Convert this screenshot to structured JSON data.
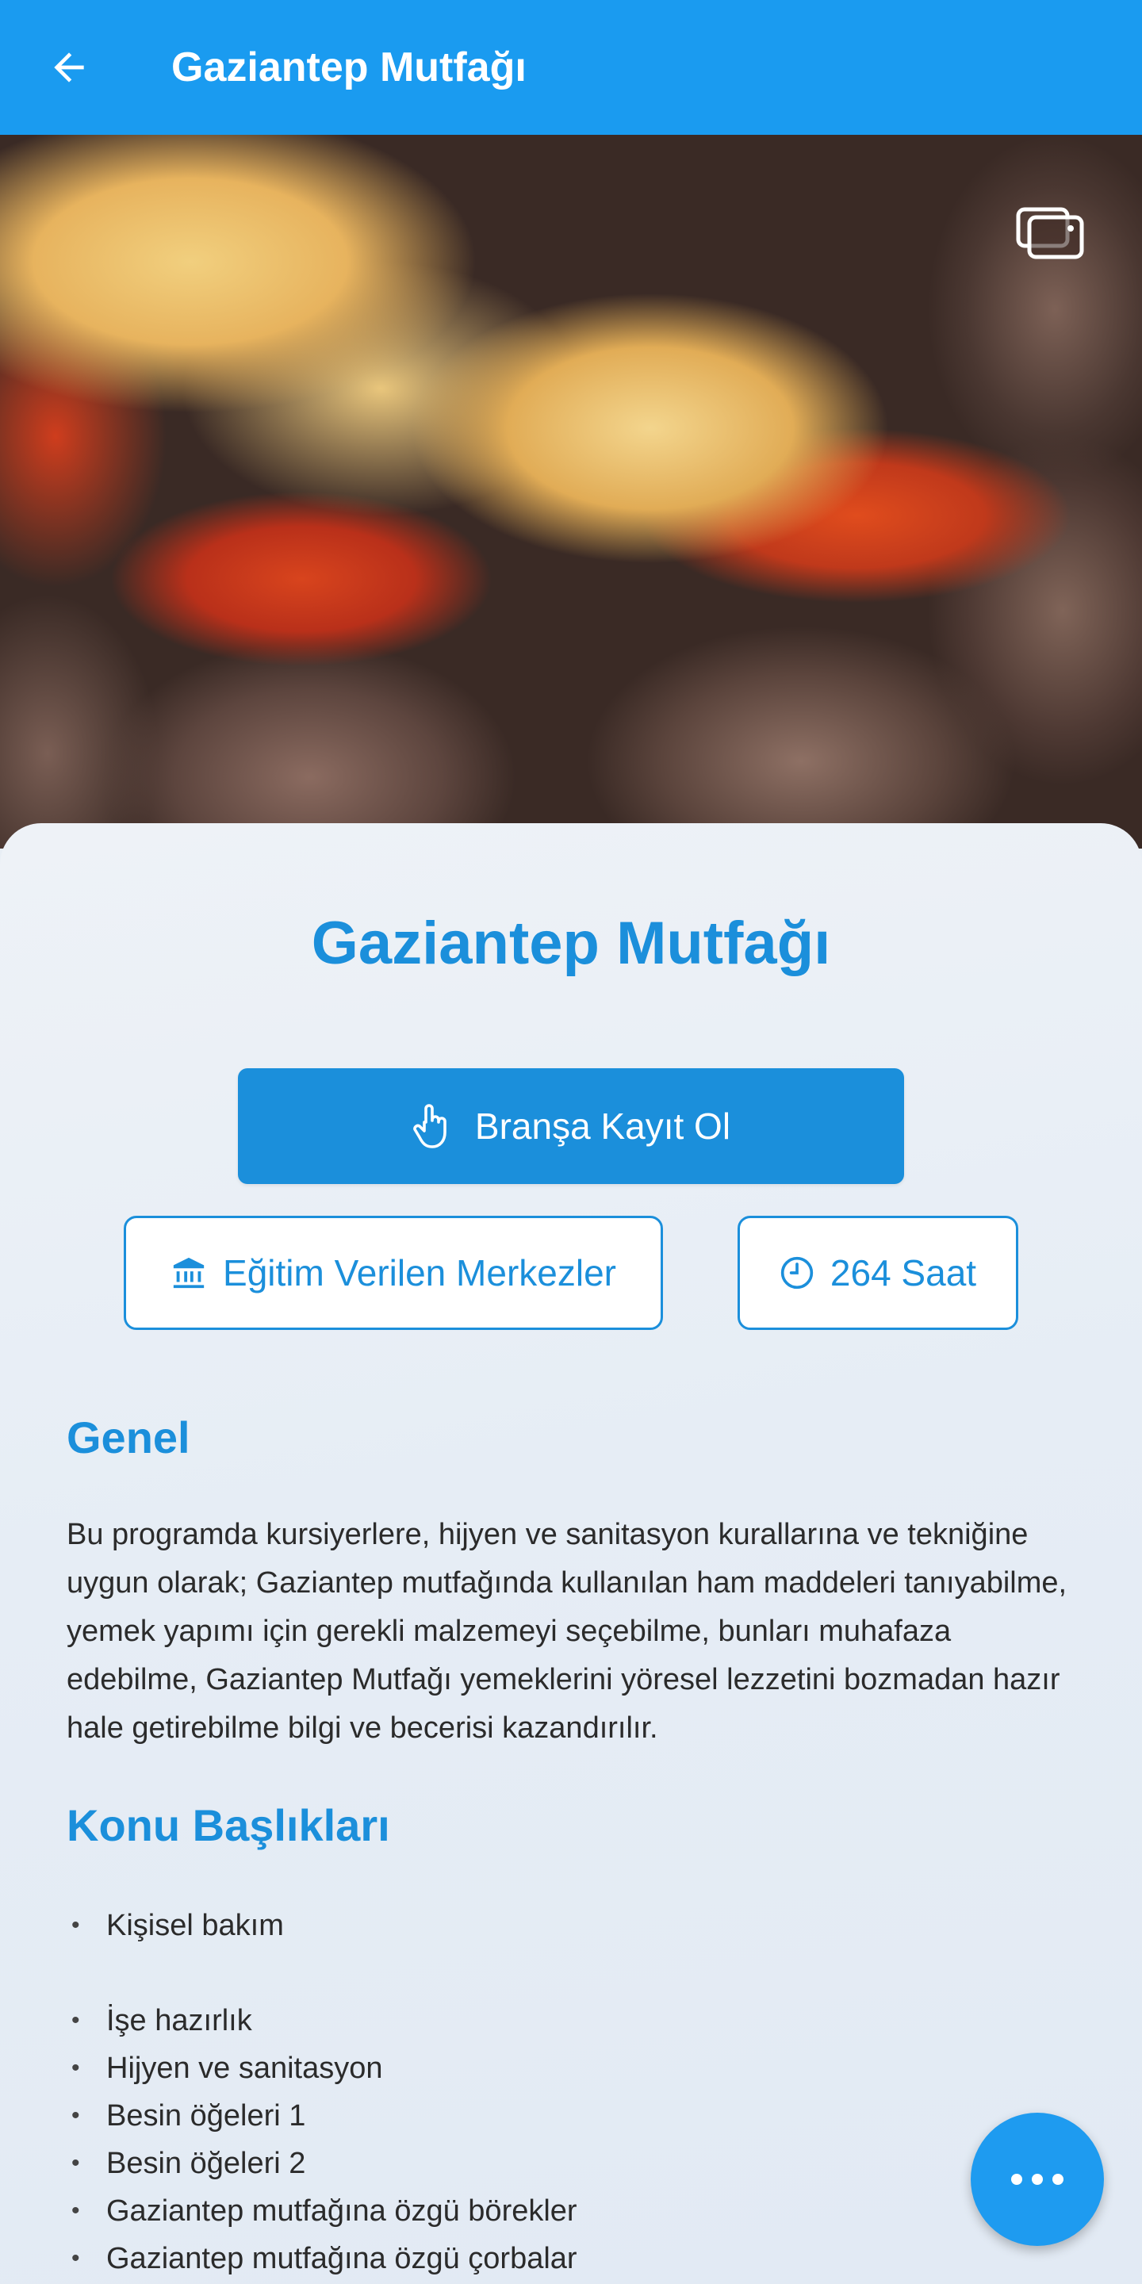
{
  "appbar": {
    "title": "Gaziantep Mutfağı",
    "back_icon": "arrow-left-icon"
  },
  "hero": {
    "gallery_icon": "gallery-icon"
  },
  "content": {
    "title": "Gaziantep Mutfağı",
    "register_label": "Branşa Kayıt Ol",
    "centers_label": "Eğitim Verilen Merkezler",
    "hours_label": "264 Saat",
    "general_heading": "Genel",
    "general_text": "Bu programda kursiyerlere, hijyen ve sanitasyon kurallarına ve tekniğine uygun olarak; Gaziantep mutfağında kullanılan ham maddeleri tanıyabilme, yemek yapımı için gerekli malzemeyi seçebilme, bunları muhafaza edebilme, Gaziantep Mutfağı yemeklerini yöresel lezzetini bozmadan hazır hale getirebilme bilgi ve becerisi kazandırılır.",
    "topics_heading": "Konu Başlıkları",
    "topics": [
      "Kişisel bakım",
      "İşe hazırlık",
      "Hijyen ve sanitasyon",
      "Besin öğeleri 1",
      "Besin öğeleri 2",
      "Gaziantep mutfağına özgü börekler",
      "Gaziantep mutfağına özgü çorbalar"
    ]
  },
  "colors": {
    "primary": "#1a9bf0",
    "accent": "#1b8fdb"
  },
  "fab": {
    "icon": "more-horizontal-icon"
  }
}
